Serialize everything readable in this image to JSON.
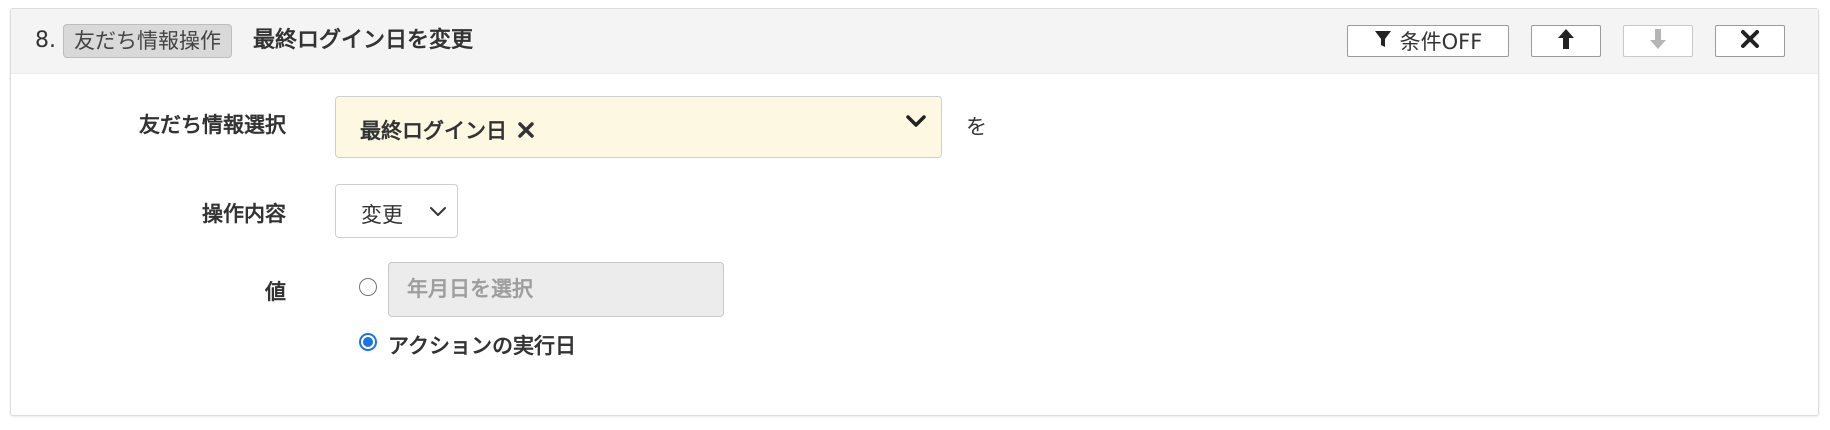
{
  "header": {
    "step_number": "8.",
    "category_tag": "友だち情報操作",
    "title": "最終ログイン日を変更",
    "buttons": {
      "filter_label": "条件OFF",
      "filter_icon": "filter-icon",
      "move_up_icon": "arrow-up-icon",
      "move_down_icon": "arrow-down-icon",
      "delete_icon": "close-icon",
      "move_down_disabled": true
    }
  },
  "form": {
    "friend_info_select": {
      "label": "友だち情報選択",
      "selected_chip": "最終ログイン日",
      "background_color": "#fdf8e1",
      "particle": "を"
    },
    "operation": {
      "label": "操作内容",
      "selected": "変更"
    },
    "value": {
      "label": "値",
      "options": [
        {
          "type": "date",
          "placeholder": "年月日を選択",
          "checked": false
        },
        {
          "type": "action_date",
          "label": "アクションの実行日",
          "checked": true
        }
      ]
    }
  },
  "colors": {
    "header_bg": "#f4f4f4",
    "tag_bg": "#d9d9d9",
    "radio_accent": "#1a73e8",
    "disabled_icon": "#b5b5b5"
  }
}
